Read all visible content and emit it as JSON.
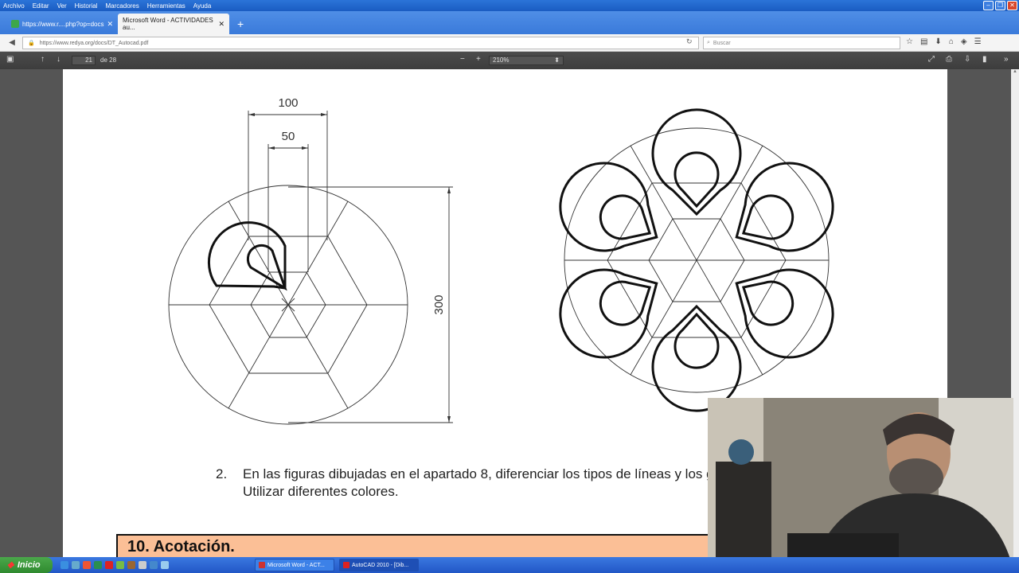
{
  "menu": [
    "Archivo",
    "Editar",
    "Ver",
    "Historial",
    "Marcadores",
    "Herramientas",
    "Ayuda"
  ],
  "tabs": [
    {
      "label": "https://www.r....php?op=docs"
    },
    {
      "label": "Microsoft Word - ACTIVIDADES au..."
    }
  ],
  "url": "https://www.redya.org/docs/DT_Autocad.pdf",
  "search_placeholder": "Buscar",
  "pdf": {
    "page": "21",
    "page_count": "de 28",
    "zoom": "210%"
  },
  "figure": {
    "dim_outer": "100",
    "dim_inner": "50",
    "dim_height": "300"
  },
  "content": {
    "item_number": "2.",
    "item_line1": "En las figuras dibujadas en el apartado 8, diferenciar los tipos de líneas y los gro",
    "item_line2": "Utilizar diferentes colores.",
    "heading": "10. Acotación."
  },
  "taskbar": {
    "start": "Inicio",
    "tasks": [
      {
        "label": "Microsoft Word - ACT..."
      },
      {
        "label": "AutoCAD 2010 - [Dib..."
      }
    ]
  },
  "colors": {
    "accent_orange": "#fbbf96",
    "taskbar_blue": "#2a62d0",
    "start_green": "#3a9a3a"
  }
}
